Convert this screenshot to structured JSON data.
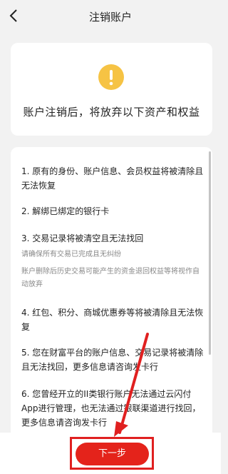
{
  "header": {
    "title": "注销账户"
  },
  "warning": {
    "text": "账户注销后，将放弃以下资产和权益"
  },
  "items": [
    "1. 原有的身份、账户信息、会员权益将被清除且无法恢复",
    "2. 解绑已绑定的银行卡",
    "3. 交易记录将被清空且无法找回",
    "4. 红包、积分、商城优惠券等将被清除且无法恢复",
    "5. 您在财富平台的账户信息、交易记录将被清除且无法找回，更多信息请咨询发卡行",
    "6. 您曾经开立的II类银行账户无法通过云闪付App进行管理，也无法通过银联渠道进行找回，更多信息请咨询发卡行"
  ],
  "notes": [
    "请确保所有交易已完成且无纠纷",
    "账户删除后历史交易可能产生的资金退回权益等将视作自动放弃"
  ],
  "footer": {
    "next_label": "下一步"
  },
  "colors": {
    "accent": "#e4231b",
    "warning": "#f6c344",
    "highlight": "#e02020"
  }
}
